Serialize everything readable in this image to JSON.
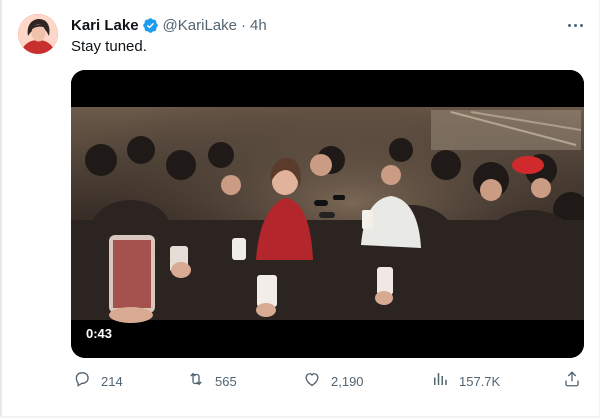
{
  "tweet": {
    "display_name": "Kari Lake",
    "handle": "@KariLake",
    "separator": "·",
    "time": "4h",
    "text": "Stay tuned.",
    "verified_icon": "verified-badge-icon",
    "more_icon": "more-options-icon"
  },
  "media": {
    "type": "video",
    "duration": "0:43"
  },
  "actions": {
    "replies": "214",
    "reposts": "565",
    "likes": "2,190",
    "views": "157.7K",
    "reply_icon": "reply-icon",
    "repost_icon": "repost-icon",
    "like_icon": "like-icon",
    "views_icon": "views-icon",
    "share_icon": "share-icon"
  },
  "colors": {
    "text": "#0f1419",
    "secondary": "#536471",
    "verified": "#1d9bf0"
  }
}
